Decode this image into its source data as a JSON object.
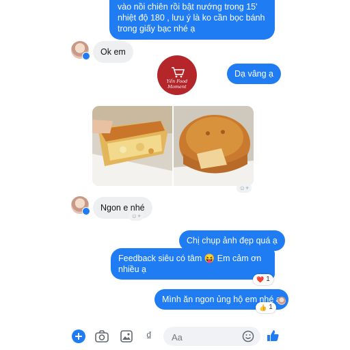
{
  "messages": {
    "top_bubble": "vào nồi chiên rồi bật nướng trong 15' nhiệt độ 180 , lưu ý là ko cần bọc bánh trong giấy bạc nhé ạ",
    "ok_em": "Ok em",
    "da_vang_a": "Dạ vâng ạ",
    "ngon_e_nhe": "Ngon e nhé",
    "chi_chup_anh": "Chị chụp ảnh đẹp quá ạ",
    "feedback": "Feedback siêu có tâm 😝 Em cảm ơn nhiều ạ",
    "minh_an_ngon": "Mình ăn ngon ủng hộ em nhé ạ"
  },
  "watermark": {
    "text": "Yến Food Moment"
  },
  "reactions": {
    "feedback": {
      "emoji": "❤️",
      "count": "1"
    },
    "minh_an_ngon": {
      "emoji": "👍",
      "count": "1"
    }
  },
  "composer": {
    "placeholder": "Aa",
    "icons": [
      "plus-icon",
      "camera-icon",
      "gallery-icon",
      "currency-icon",
      "emoji-icon",
      "like-icon"
    ]
  },
  "colors": {
    "accent": "#1f7cf2",
    "incoming_bubble": "#eeeff1",
    "watermark": "#b5262b"
  }
}
